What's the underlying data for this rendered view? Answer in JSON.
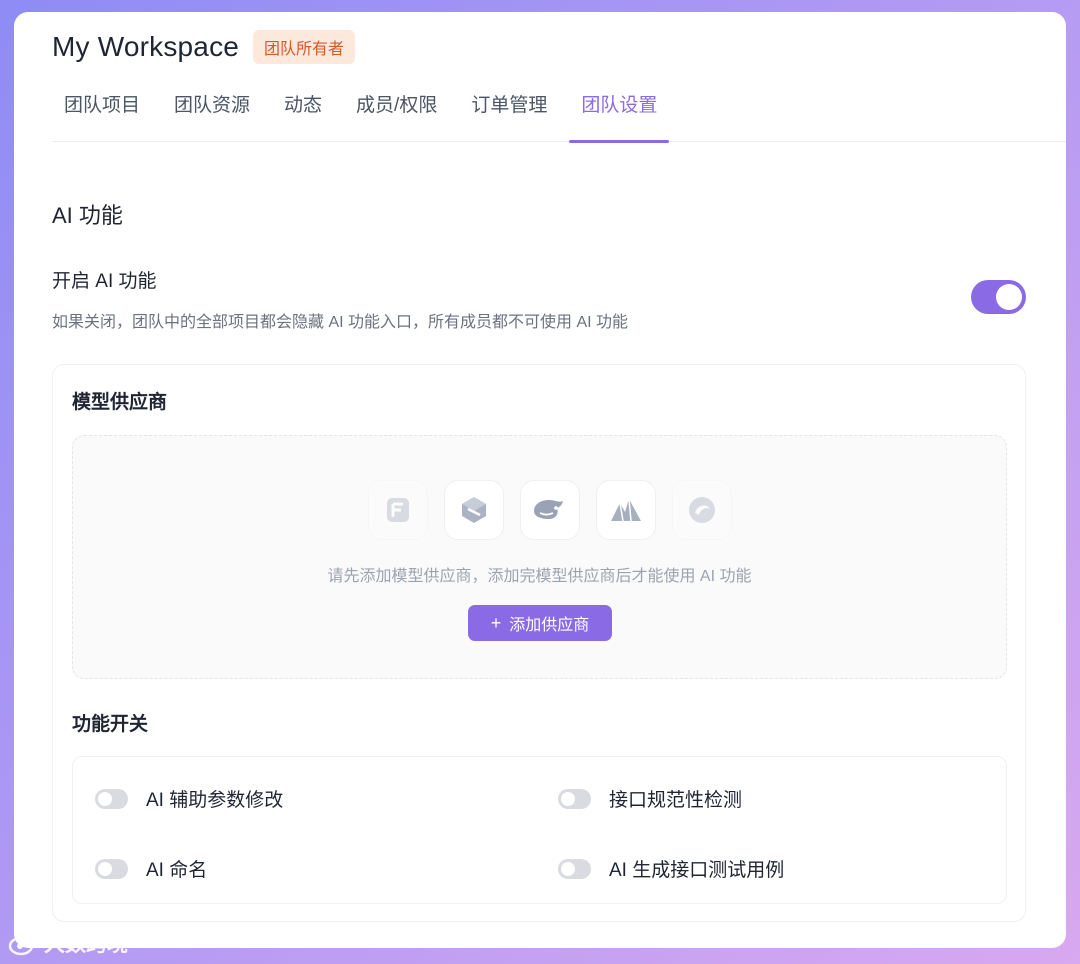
{
  "header": {
    "workspace_title": "My Workspace",
    "role_badge": "团队所有者"
  },
  "tabs": [
    {
      "label": "团队项目",
      "active": false
    },
    {
      "label": "团队资源",
      "active": false
    },
    {
      "label": "动态",
      "active": false
    },
    {
      "label": "成员/权限",
      "active": false
    },
    {
      "label": "订单管理",
      "active": false
    },
    {
      "label": "团队设置",
      "active": true
    }
  ],
  "ai_section": {
    "title": "AI 功能",
    "enable_title": "开启 AI 功能",
    "enable_desc": "如果关闭，团队中的全部项目都会隐藏 AI 功能入口，所有成员都不可使用 AI 功能",
    "enabled": true
  },
  "providers": {
    "title": "模型供应商",
    "logos": [
      "provider-logo-f",
      "provider-logo-cube",
      "deepseek-whale-logo",
      "mountain-logo",
      "swirl-logo"
    ],
    "empty_text": "请先添加模型供应商，添加完模型供应商后才能使用 AI 功能",
    "add_button": "添加供应商"
  },
  "features": {
    "title": "功能开关",
    "items": [
      {
        "label": "AI 辅助参数修改",
        "enabled": false
      },
      {
        "label": "接口规范性检测",
        "enabled": false
      },
      {
        "label": "AI 命名",
        "enabled": false
      },
      {
        "label": "AI 生成接口测试用例",
        "enabled": false
      }
    ]
  },
  "watermark": "大数跨境",
  "colors": {
    "accent": "#8b6ae6",
    "badge_bg": "#fde8dc",
    "badge_text": "#d35a2d"
  }
}
